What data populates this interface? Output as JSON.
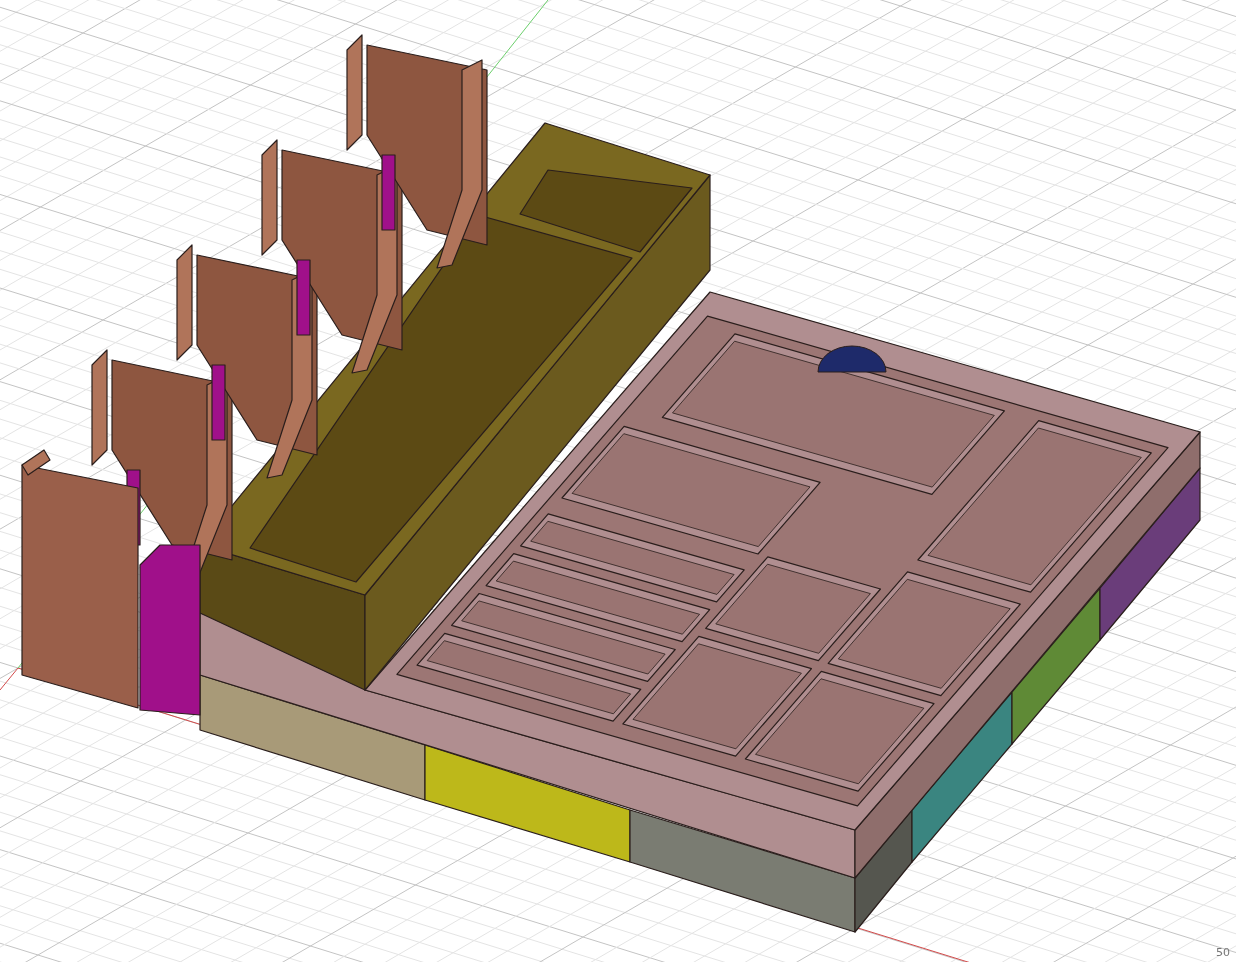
{
  "viewport": {
    "scale_label": "50"
  }
}
